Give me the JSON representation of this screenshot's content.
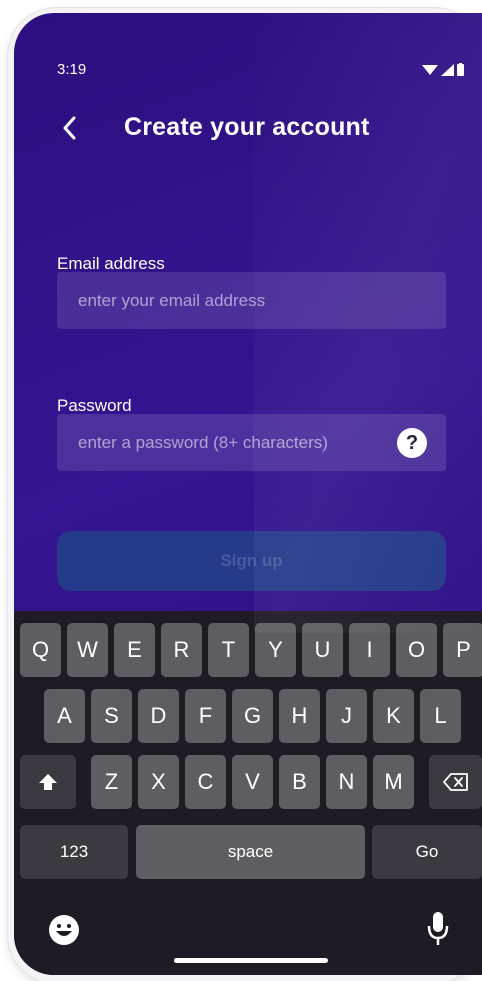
{
  "status_bar": {
    "time": "3:19"
  },
  "header": {
    "title": "Create your account"
  },
  "form": {
    "email_label": "Email address",
    "email_placeholder": "enter your email address",
    "email_value": "",
    "password_label": "Password",
    "password_placeholder": "enter a password (8+ characters)",
    "password_value": "",
    "help_glyph": "?",
    "signup_label": "Sign up"
  },
  "keyboard": {
    "row1": [
      "Q",
      "W",
      "E",
      "R",
      "T",
      "Y",
      "U",
      "I",
      "O",
      "P"
    ],
    "row2": [
      "A",
      "S",
      "D",
      "F",
      "G",
      "H",
      "J",
      "K",
      "L"
    ],
    "row3": [
      "Z",
      "X",
      "C",
      "V",
      "B",
      "N",
      "M"
    ],
    "numbers_label": "123",
    "space_label": "space",
    "go_label": "Go"
  },
  "icons": {
    "back": "chevron-left-icon",
    "wifi": "wifi-icon",
    "signal": "cell-signal-icon",
    "battery": "battery-icon",
    "help": "question-mark-icon",
    "shift": "shift-arrow-icon",
    "backspace": "backspace-icon",
    "emoji": "emoji-icon",
    "mic": "microphone-icon"
  },
  "colors": {
    "background": "#2d0f80",
    "signup_button": "#263a8a",
    "key": "#5e5e62",
    "key_dark": "#3c3a40"
  }
}
